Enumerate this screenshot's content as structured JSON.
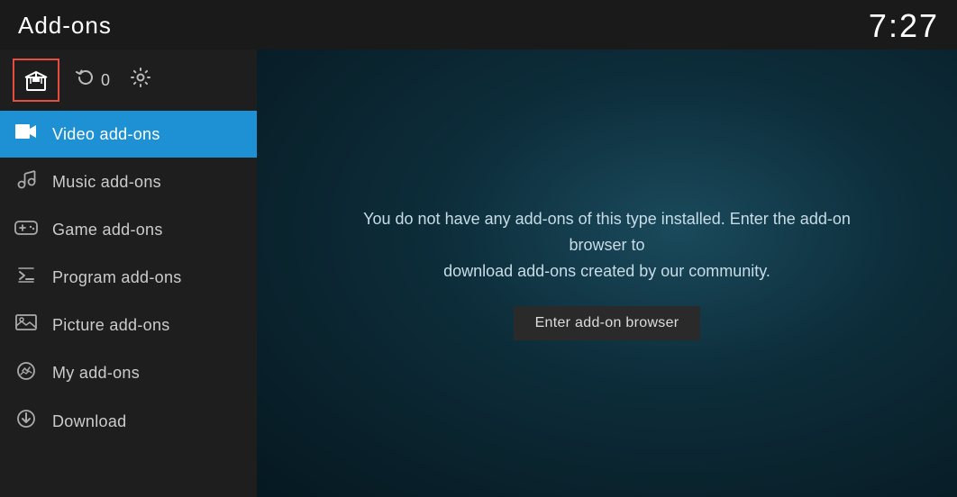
{
  "header": {
    "title": "Add-ons",
    "time": "7:27"
  },
  "toolbar": {
    "count": "0"
  },
  "nav": {
    "items": [
      {
        "id": "video",
        "label": "Video add-ons",
        "icon": "video",
        "active": true
      },
      {
        "id": "music",
        "label": "Music add-ons",
        "icon": "music",
        "active": false
      },
      {
        "id": "game",
        "label": "Game add-ons",
        "icon": "game",
        "active": false
      },
      {
        "id": "program",
        "label": "Program add-ons",
        "icon": "program",
        "active": false
      },
      {
        "id": "picture",
        "label": "Picture add-ons",
        "icon": "picture",
        "active": false
      },
      {
        "id": "myadons",
        "label": "My add-ons",
        "icon": "myadons",
        "active": false
      },
      {
        "id": "download",
        "label": "Download",
        "icon": "download",
        "active": false
      }
    ]
  },
  "main": {
    "empty_message": "You do not have any add-ons of this type installed. Enter the add-on browser to\ndownload add-ons created by our community.",
    "browser_button_label": "Enter add-on browser"
  }
}
